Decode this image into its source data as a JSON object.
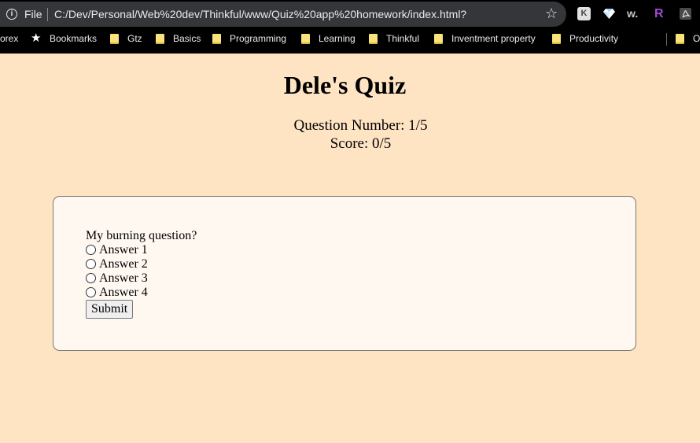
{
  "browser": {
    "scheme": "File",
    "url": "C:/Dev/Personal/Web%20dev/Thinkful/www/Quiz%20app%20homework/index.html?",
    "ext_k_label": "K",
    "ext_w_label": "w.",
    "ext_r_label": "R",
    "bookmarks": {
      "cut_left": "orex",
      "bookmarks": "Bookmarks",
      "gtz": "Gtz",
      "basics": "Basics",
      "programming": "Programming",
      "learning": "Learning",
      "thinkful": "Thinkful",
      "inventment": "Inventment property",
      "productivity": "Productivity",
      "cut_right": "O"
    }
  },
  "page": {
    "title": "Dele's Quiz",
    "question_number": "Question Number: 1/5",
    "score": "Score: 0/5"
  },
  "quiz": {
    "question": "My burning question?",
    "answers": [
      "Answer 1",
      "Answer 2",
      "Answer 3",
      "Answer 4"
    ],
    "submit_label": "Submit"
  },
  "colors": {
    "page_background": "#ffe4c4",
    "card_background": "#fff8f1",
    "chrome_background": "#000000",
    "address_bar": "#35363a",
    "folder_icon": "#f9e37a"
  }
}
